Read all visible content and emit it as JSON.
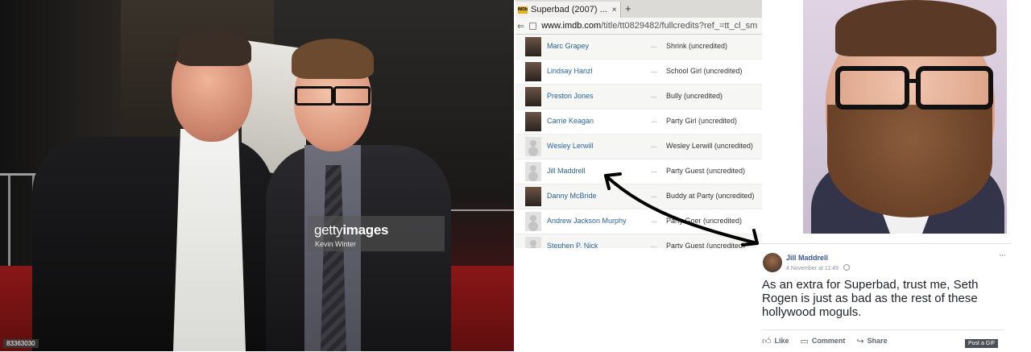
{
  "left_photo": {
    "watermark_brand_light": "getty",
    "watermark_brand_bold": "images",
    "watermark_credit": "Kevin Winter",
    "photo_id": "83363030"
  },
  "browser": {
    "tab_title": "Superbad (2007) ...",
    "tab_close": "×",
    "new_tab": "+",
    "url_domain": "www.imdb.com",
    "url_path": "/title/tt0829482/fullcredits?ref_=tt_cl_sm",
    "favicon_text": "IMDb"
  },
  "cast": [
    {
      "name": "Marc Grapey",
      "dots": "...",
      "role": "Shrink (uncredited)",
      "photo": "real"
    },
    {
      "name": "Lindsay Hanzl",
      "dots": "...",
      "role": "School Girl (uncredited)",
      "photo": "real"
    },
    {
      "name": "Preston Jones",
      "dots": "...",
      "role": "Bully (uncredited)",
      "photo": "real"
    },
    {
      "name": "Carrie Keagan",
      "dots": "...",
      "role": "Party Girl (uncredited)",
      "photo": "real"
    },
    {
      "name": "Wesley Lerwill",
      "dots": "...",
      "role": "Wesley Lerwill (uncredited)",
      "photo": "placeholder"
    },
    {
      "name": "Jill Maddrell",
      "dots": "...",
      "role": "Party Guest (uncredited)",
      "photo": "placeholder"
    },
    {
      "name": "Danny McBride",
      "dots": "...",
      "role": "Buddy at Party (uncredited)",
      "photo": "real"
    },
    {
      "name": "Andrew Jackson Murphy",
      "dots": "...",
      "role": "Party Goer (uncredited)",
      "photo": "placeholder"
    },
    {
      "name": "Stephen P. Nick",
      "dots": "...",
      "role": "Party Guest (uncredited)",
      "photo": "placeholder"
    }
  ],
  "fb_post": {
    "author": "Jill Maddrell",
    "date": "4 November at 11:49 ·",
    "more": "···",
    "text": "As an extra for Superbad, trust me, Seth Rogen is just as bad as the rest of these hollywood moguls.",
    "like_label": "Like",
    "comment_label": "Comment",
    "share_label": "Share",
    "gif_label": "Post a GIF"
  },
  "colors": {
    "imdb_link": "#2a6496",
    "fb_author": "#365899",
    "red_carpet": "#8a1717"
  }
}
